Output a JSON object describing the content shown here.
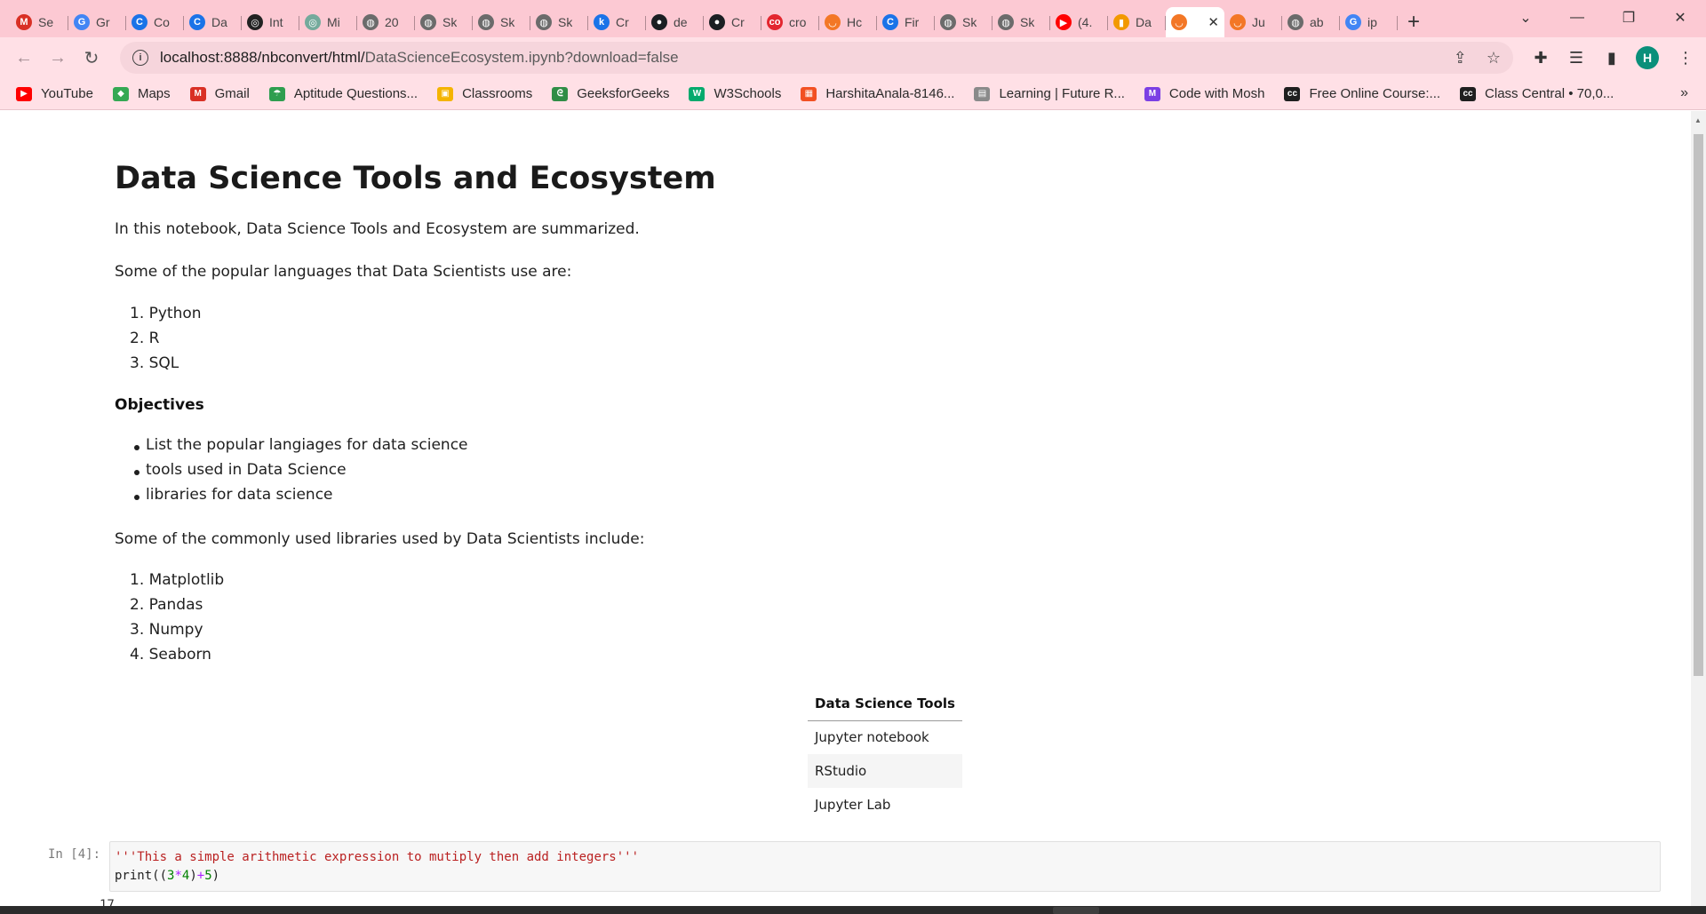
{
  "browser": {
    "tabs": [
      {
        "label": "Se",
        "icon": "gmail-icon",
        "color": "#d93025",
        "glyph": "M"
      },
      {
        "label": "Gr",
        "icon": "google-icon",
        "color": "#4285f4",
        "glyph": "G"
      },
      {
        "label": "Co",
        "icon": "c-icon",
        "color": "#1a73e8",
        "glyph": "C"
      },
      {
        "label": "Da",
        "icon": "c-icon",
        "color": "#1a73e8",
        "glyph": "C"
      },
      {
        "label": "Int",
        "icon": "openai-icon",
        "color": "#222222",
        "glyph": "◎"
      },
      {
        "label": "Mi",
        "icon": "openai-icon",
        "color": "#74aa9c",
        "glyph": "◎"
      },
      {
        "label": "20",
        "icon": "globe-icon",
        "color": "#6b6b6b",
        "glyph": "◍"
      },
      {
        "label": "Sk",
        "icon": "globe-icon",
        "color": "#6b6b6b",
        "glyph": "◍"
      },
      {
        "label": "Sk",
        "icon": "globe-icon",
        "color": "#6b6b6b",
        "glyph": "◍"
      },
      {
        "label": "Sk",
        "icon": "globe-icon",
        "color": "#6b6b6b",
        "glyph": "◍"
      },
      {
        "label": "Cr",
        "icon": "k-icon",
        "color": "#1a73e8",
        "glyph": "k"
      },
      {
        "label": "de",
        "icon": "github-icon",
        "color": "#1b1f23",
        "glyph": "●"
      },
      {
        "label": "Cr",
        "icon": "github-icon",
        "color": "#1b1f23",
        "glyph": "●"
      },
      {
        "label": "cro",
        "icon": "coursera-icon",
        "color": "#e3262f",
        "glyph": "co"
      },
      {
        "label": "Hc",
        "icon": "jupyter-icon",
        "color": "#f37726",
        "glyph": "◡"
      },
      {
        "label": "Fir",
        "icon": "c-icon",
        "color": "#1a73e8",
        "glyph": "C"
      },
      {
        "label": "Sk",
        "icon": "globe-icon",
        "color": "#6b6b6b",
        "glyph": "◍"
      },
      {
        "label": "Sk",
        "icon": "globe-icon",
        "color": "#6b6b6b",
        "glyph": "◍"
      },
      {
        "label": "(4.",
        "icon": "youtube-icon",
        "color": "#ff0000",
        "glyph": "▶"
      },
      {
        "label": "Da",
        "icon": "book-icon",
        "color": "#f29900",
        "glyph": "▮"
      },
      {
        "label": "",
        "icon": "jupyter-icon",
        "color": "#f37726",
        "glyph": "◡",
        "active": true
      },
      {
        "label": "Ju",
        "icon": "jupyter-icon",
        "color": "#f37726",
        "glyph": "◡"
      },
      {
        "label": "ab",
        "icon": "globe-icon",
        "color": "#6b6b6b",
        "glyph": "◍"
      },
      {
        "label": "ip",
        "icon": "google-icon",
        "color": "#4285f4",
        "glyph": "G"
      }
    ],
    "url_host": "localhost:8888/nbconvert/html/",
    "url_path": "DataScienceEcosystem.ipynb?download=false",
    "avatar_letter": "H",
    "bookmarks": [
      {
        "label": "YouTube",
        "icon": "youtube-icon",
        "color": "#ff0000",
        "glyph": "▶"
      },
      {
        "label": "Maps",
        "icon": "maps-icon",
        "color": "#34a853",
        "glyph": "◆"
      },
      {
        "label": "Gmail",
        "icon": "gmail-icon",
        "color": "#d93025",
        "glyph": "M"
      },
      {
        "label": "Aptitude Questions...",
        "icon": "umbrella-icon",
        "color": "#2e9e4f",
        "glyph": "☂"
      },
      {
        "label": "Classrooms",
        "icon": "classroom-icon",
        "color": "#f4b400",
        "glyph": "▣"
      },
      {
        "label": "GeeksforGeeks",
        "icon": "gfg-icon",
        "color": "#2f8d46",
        "glyph": "ᘓ"
      },
      {
        "label": "W3Schools",
        "icon": "w3schools-icon",
        "color": "#04aa6d",
        "glyph": "W"
      },
      {
        "label": "HarshitaAnala-8146...",
        "icon": "microsoft-icon",
        "color": "#f25022",
        "glyph": "▦"
      },
      {
        "label": "Learning | Future R...",
        "icon": "futurer-icon",
        "color": "#8a8a8a",
        "glyph": "▤"
      },
      {
        "label": "Code with Mosh",
        "icon": "mosh-icon",
        "color": "#7b3fe4",
        "glyph": "M"
      },
      {
        "label": "Free Online Course:...",
        "icon": "classcentral-icon",
        "color": "#1f1f1f",
        "glyph": "cc"
      },
      {
        "label": "Class Central • 70,0...",
        "icon": "classcentral-icon",
        "color": "#1f1f1f",
        "glyph": "cc"
      }
    ]
  },
  "notebook": {
    "title": "Data Science Tools and Ecosystem",
    "intro": "In this notebook, Data Science Tools and Ecosystem are summarized.",
    "languages_intro": "Some of the popular languages that Data Scientists use are:",
    "languages": [
      "1. Python",
      "2. R",
      "3. SQL"
    ],
    "objectives_heading": "Objectives",
    "objectives": [
      "List the popular langiages for data science",
      "tools used in Data Science",
      "libraries for data science"
    ],
    "libraries_intro": "Some of the commonly used libraries used by Data Scientists include:",
    "libraries": [
      "1. Matplotlib",
      "2. Pandas",
      "3. Numpy",
      "4. Seaborn"
    ],
    "tools_table_header": "Data Science Tools",
    "tools": [
      "Jupyter notebook",
      "RStudio",
      "Jupyter Lab"
    ],
    "cell_prompt": "In [4]:",
    "code_line1": "'''This a simple arithmetic expression to mutiply then add integers'''",
    "code_line2_fn": "print",
    "code_line2_open": "((",
    "code_line2_a": "3",
    "code_line2_op1": "*",
    "code_line2_b": "4",
    "code_line2_mid": ")",
    "code_line2_op2": "+",
    "code_line2_c": "5",
    "code_line2_close": ")",
    "output_partial": "17"
  }
}
